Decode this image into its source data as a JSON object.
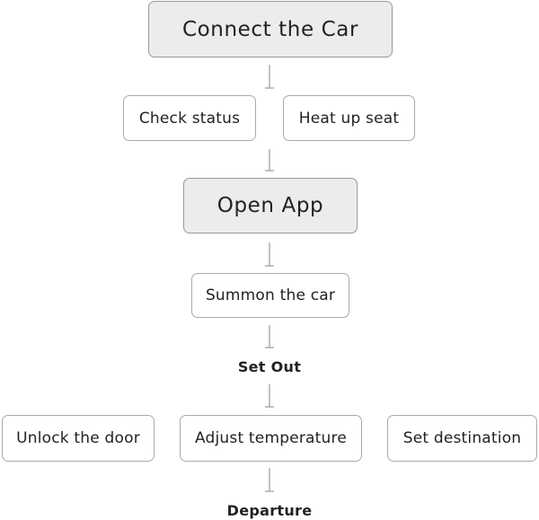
{
  "steps": {
    "connect": "Connect the Car",
    "check_status": "Check status",
    "heat_seat": "Heat up seat",
    "open_app": "Open App",
    "summon": "Summon the car",
    "set_out": "Set Out",
    "unlock": "Unlock the door",
    "adjust_temp": "Adjust temperature",
    "set_destination": "Set destination",
    "departure": "Departure"
  },
  "colors": {
    "primary_fill": "#ececec",
    "border": "#aaaaaa",
    "connector": "#999999"
  }
}
